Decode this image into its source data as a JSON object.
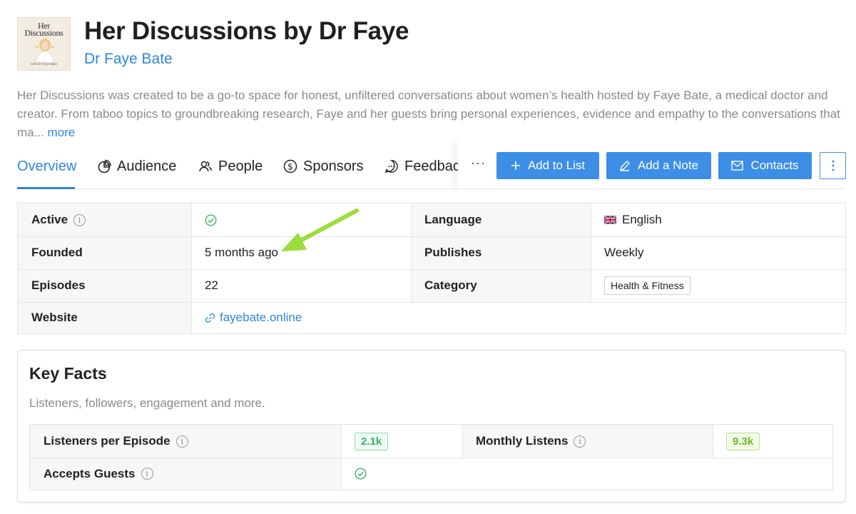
{
  "podcast": {
    "cover": {
      "title_line1": "Her",
      "title_line2": "Discussions",
      "byline": "with Dr Faye Bate"
    },
    "title": "Her Discussions by Dr Faye",
    "author": "Dr Faye Bate",
    "description": "Her Discussions was created to be a go-to space for honest, unfiltered conversations about women’s health hosted by Faye Bate, a medical doctor and creator. From taboo topics to groundbreaking research, Faye and her guests bring personal experiences, evidence and empathy to the conversations that ma...",
    "more_label": "more"
  },
  "tabs": [
    {
      "label": "Overview",
      "icon": "none",
      "active": true
    },
    {
      "label": "Audience",
      "icon": "pie-chart-icon"
    },
    {
      "label": "People",
      "icon": "people-icon"
    },
    {
      "label": "Sponsors",
      "icon": "dollar-icon"
    },
    {
      "label": "Feedbac",
      "icon": "chat-icon"
    }
  ],
  "toolbar": {
    "overflow": "···",
    "add_to_list": "Add to List",
    "add_note": "Add a Note",
    "contacts": "Contacts"
  },
  "info": {
    "active_label": "Active",
    "founded_label": "Founded",
    "founded_value": "5 months ago",
    "episodes_label": "Episodes",
    "episodes_value": "22",
    "website_label": "Website",
    "website_value": "fayebate.online",
    "language_label": "Language",
    "language_value": "English",
    "publishes_label": "Publishes",
    "publishes_value": "Weekly",
    "category_label": "Category",
    "category_value": "Health & Fitness"
  },
  "key_facts": {
    "title": "Key Facts",
    "subtitle": "Listeners, followers, engagement and more.",
    "listeners_label": "Listeners per Episode",
    "listeners_value": "2.1k",
    "monthly_label": "Monthly Listens",
    "monthly_value": "9.3k",
    "guests_label": "Accepts Guests"
  },
  "colors": {
    "accent": "#2e86de",
    "button": "#3d8ee6",
    "success": "#38b36a",
    "annotation_arrow": "#9cdc3c"
  }
}
